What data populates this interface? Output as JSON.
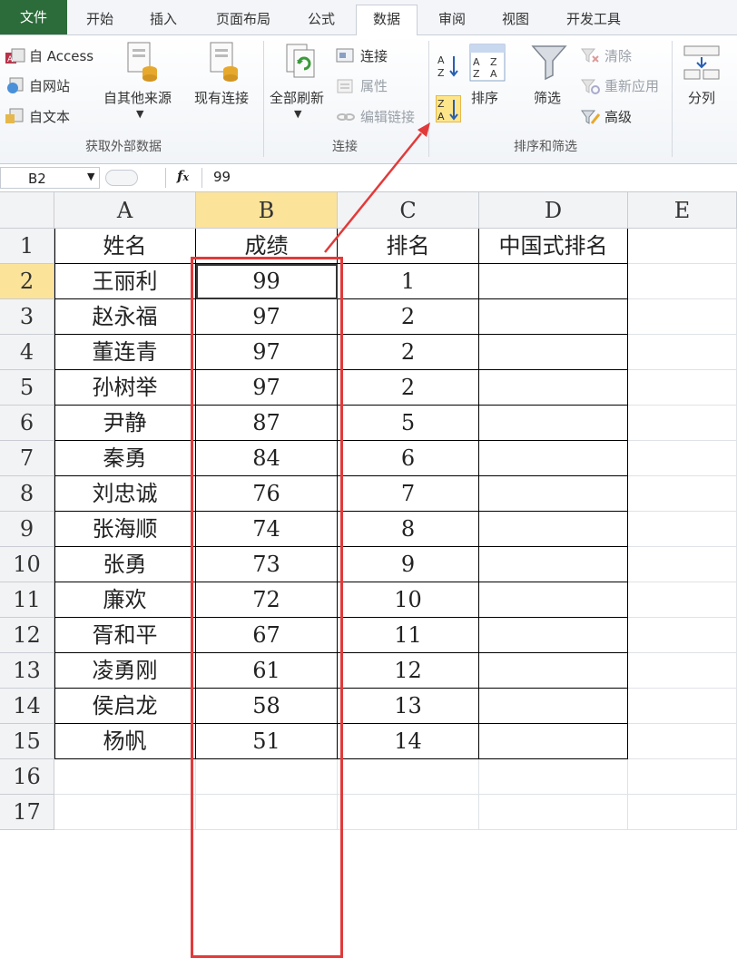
{
  "tabs": [
    "文件",
    "开始",
    "插入",
    "页面布局",
    "公式",
    "数据",
    "审阅",
    "视图",
    "开发工具"
  ],
  "ribbon": {
    "get_external": {
      "access": "自 Access",
      "web": "自网站",
      "text": "自文本",
      "other_sources": "自其他来源",
      "existing": "现有连接",
      "group_label": "获取外部数据"
    },
    "connections": {
      "refresh_all": "全部刷新",
      "connections": "连接",
      "properties": "属性",
      "edit_links": "编辑链接",
      "group_label": "连接"
    },
    "sort_filter": {
      "sort": "排序",
      "filter": "筛选",
      "clear": "清除",
      "reapply": "重新应用",
      "advanced": "高级",
      "group_label": "排序和筛选"
    },
    "data_tools": {
      "split": "分列"
    }
  },
  "formula_bar": {
    "name_box": "B2",
    "value": "99"
  },
  "sheet": {
    "columns": [
      "A",
      "B",
      "C",
      "D",
      "E"
    ],
    "headers": [
      "姓名",
      "成绩",
      "排名",
      "中国式排名"
    ],
    "rows": [
      {
        "name": "王丽利",
        "score": "99",
        "rank": "1"
      },
      {
        "name": "赵永福",
        "score": "97",
        "rank": "2"
      },
      {
        "name": "董连青",
        "score": "97",
        "rank": "2"
      },
      {
        "name": "孙树举",
        "score": "97",
        "rank": "2"
      },
      {
        "name": "尹静",
        "score": "87",
        "rank": "5"
      },
      {
        "name": "秦勇",
        "score": "84",
        "rank": "6"
      },
      {
        "name": "刘忠诚",
        "score": "76",
        "rank": "7"
      },
      {
        "name": "张海顺",
        "score": "74",
        "rank": "8"
      },
      {
        "name": "张勇",
        "score": "73",
        "rank": "9"
      },
      {
        "name": "廉欢",
        "score": "72",
        "rank": "10"
      },
      {
        "name": "胥和平",
        "score": "67",
        "rank": "11"
      },
      {
        "name": "凌勇刚",
        "score": "61",
        "rank": "12"
      },
      {
        "name": "侯启龙",
        "score": "58",
        "rank": "13"
      },
      {
        "name": "杨帆",
        "score": "51",
        "rank": "14"
      }
    ],
    "row_numbers": [
      "1",
      "2",
      "3",
      "4",
      "5",
      "6",
      "7",
      "8",
      "9",
      "10",
      "11",
      "12",
      "13",
      "14",
      "15",
      "16",
      "17"
    ]
  },
  "colors": {
    "file_tab": "#2c6b3a",
    "selection_header": "#fbe39a",
    "annotation": "#e23a3a"
  },
  "icons": [
    "access-icon",
    "web-icon",
    "text-icon",
    "other-sources-icon",
    "existing-connections-icon",
    "refresh-icon",
    "connections-icon",
    "properties-icon",
    "edit-links-icon",
    "sort-asc-icon",
    "sort-desc-icon",
    "sort-dialog-icon",
    "filter-icon",
    "clear-icon",
    "reapply-icon",
    "advanced-icon",
    "text-to-columns-icon"
  ]
}
